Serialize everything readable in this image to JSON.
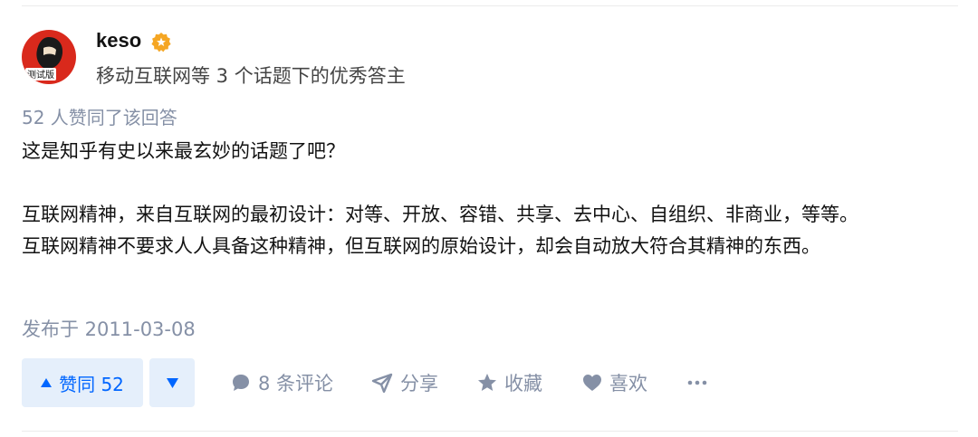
{
  "author": {
    "name": "keso",
    "headline": "移动互联网等 3 个话题下的优秀答主",
    "avatar_badge_text": "测试版"
  },
  "answer": {
    "voters_text": "52 人赞同了该回答",
    "paragraphs": [
      "这是知乎有史以来最玄妙的话题了吧？",
      "互联网精神，来自互联网的最初设计：对等、开放、容错、共享、去中心、自组织、非商业，等等。",
      "互联网精神不要求人人具备这种精神，但互联网的原始设计，却会自动放大符合其精神的东西。"
    ],
    "published": "发布于 2011-03-08"
  },
  "actions": {
    "vote_up_label": "赞同 52",
    "comments_label": "8 条评论",
    "share_label": "分享",
    "collect_label": "收藏",
    "like_label": "喜欢",
    "more_label": "···"
  },
  "colors": {
    "accent": "#0066ff",
    "accent_bg": "#e5effb",
    "muted": "#8590a6",
    "badge": "#f5a623"
  }
}
